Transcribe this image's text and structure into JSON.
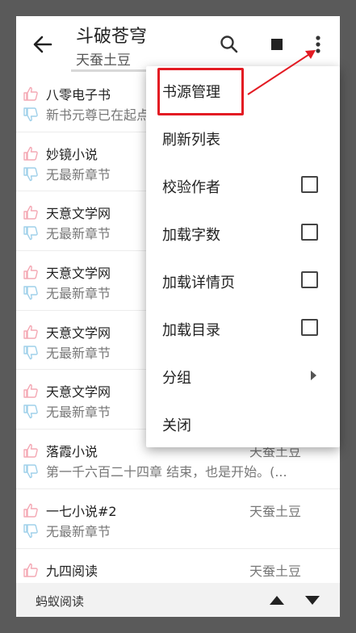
{
  "header": {
    "title": "斗破苍穹",
    "subtitle": "天蚕土豆"
  },
  "sources": [
    {
      "name": "八零电子书",
      "chapter": "新书元尊已在起点",
      "author": ""
    },
    {
      "name": "妙镜小说",
      "chapter": "无最新章节",
      "author": ""
    },
    {
      "name": "天意文学网",
      "chapter": "无最新章节",
      "author": ""
    },
    {
      "name": "天意文学网",
      "chapter": "无最新章节",
      "author": ""
    },
    {
      "name": "天意文学网",
      "chapter": "无最新章节",
      "author": ""
    },
    {
      "name": "天意文学网",
      "chapter": "无最新章节",
      "author": ""
    },
    {
      "name": "落霞小说",
      "chapter": "第一千六百二十四章 结束，也是开始。(...",
      "author": "天蚕土豆"
    },
    {
      "name": "一七小说#2",
      "chapter": "无最新章节",
      "author": "天蚕土豆"
    },
    {
      "name": "九四阅读",
      "chapter": "",
      "author": "天蚕土豆"
    }
  ],
  "menu": {
    "items": [
      {
        "label": "书源管理",
        "type": "action"
      },
      {
        "label": "刷新列表",
        "type": "action"
      },
      {
        "label": "校验作者",
        "type": "checkbox",
        "checked": false
      },
      {
        "label": "加载字数",
        "type": "checkbox",
        "checked": false
      },
      {
        "label": "加载详情页",
        "type": "checkbox",
        "checked": false
      },
      {
        "label": "加载目录",
        "type": "checkbox",
        "checked": false
      },
      {
        "label": "分组",
        "type": "submenu"
      },
      {
        "label": "关闭",
        "type": "action"
      }
    ]
  },
  "bottom": {
    "title": "蚂蚁阅读"
  },
  "colors": {
    "overlay": "#5a5a5a",
    "annotation": "#e31b23",
    "thumb_up": "#f4a8b4",
    "thumb_down": "#9fd0ea"
  }
}
